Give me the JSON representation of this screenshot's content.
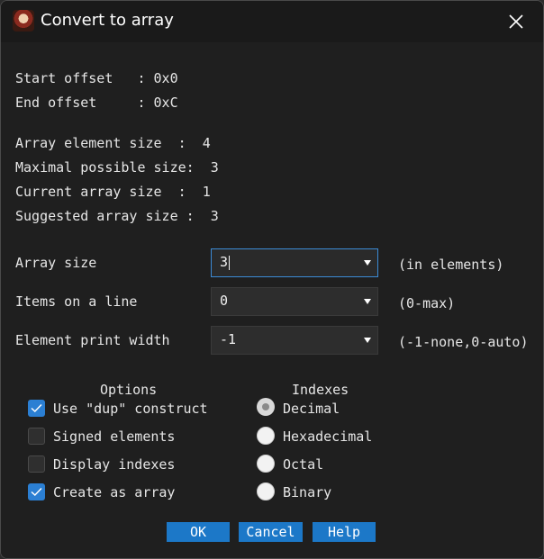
{
  "window": {
    "title": "Convert to array",
    "icon": "app-avatar-icon",
    "close_icon": "close-icon"
  },
  "info": [
    {
      "label": "Start offset   : 0x0"
    },
    {
      "label": "End offset     : 0xC"
    },
    {
      "label": "Array element size  :  4"
    },
    {
      "label": "Maximal possible size:  3"
    },
    {
      "label": "Current array size  :  1"
    },
    {
      "label": "Suggested array size :  3"
    }
  ],
  "fields": {
    "array_size": {
      "label": "Array size",
      "value": "3",
      "hint": "(in elements)"
    },
    "items_on_line": {
      "label": "Items on a line",
      "value": "0",
      "hint": "(0-max)"
    },
    "element_print_width": {
      "label": "Element print width",
      "value": "-1",
      "hint": "(-1-none,0-auto)"
    }
  },
  "options": {
    "title": "Options",
    "items": [
      {
        "label": "Use \"dup\" construct",
        "checked": true
      },
      {
        "label": "Signed elements",
        "checked": false
      },
      {
        "label": "Display indexes",
        "checked": false
      },
      {
        "label": "Create as array",
        "checked": true
      }
    ]
  },
  "indexes": {
    "title": "Indexes",
    "items": [
      {
        "label": "Decimal",
        "selected": true
      },
      {
        "label": "Hexadecimal",
        "selected": false
      },
      {
        "label": "Octal",
        "selected": false
      },
      {
        "label": "Binary",
        "selected": false
      }
    ]
  },
  "buttons": {
    "ok": "OK",
    "cancel": "Cancel",
    "help": "Help"
  },
  "colors": {
    "accent": "#1c78c8",
    "check_blue": "#2b7fd3",
    "background": "#1f1f1f",
    "focus_border": "#3c8bd6"
  }
}
